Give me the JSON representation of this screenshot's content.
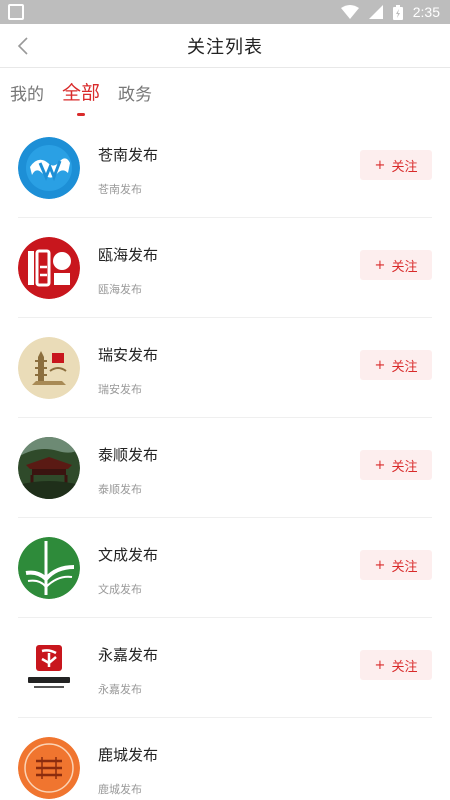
{
  "status_bar": {
    "time": "2:35"
  },
  "nav": {
    "title": "关注列表"
  },
  "tabs": [
    {
      "label": "我的",
      "active": false
    },
    {
      "label": "全部",
      "active": true
    },
    {
      "label": "政务",
      "active": false
    }
  ],
  "follow": {
    "plus": "+",
    "label": "关注"
  },
  "items": [
    {
      "name": "苍南发布",
      "sub": "苍南发布",
      "icon": "cangnan-logo-icon"
    },
    {
      "name": "瓯海发布",
      "sub": "瓯海发布",
      "icon": "ouhai-seal-icon"
    },
    {
      "name": "瑞安发布",
      "sub": "瑞安发布",
      "icon": "ruian-pagoda-icon"
    },
    {
      "name": "泰顺发布",
      "sub": "泰顺发布",
      "icon": "taishun-bridge-icon"
    },
    {
      "name": "文成发布",
      "sub": "文成发布",
      "icon": "wencheng-logo-icon"
    },
    {
      "name": "永嘉发布",
      "sub": "永嘉发布",
      "icon": "yongjia-logo-icon"
    },
    {
      "name": "鹿城发布",
      "sub": "鹿城发布",
      "icon": "lucheng-seal-icon"
    }
  ],
  "colors": {
    "accent": "#d92b2b",
    "follow_bg": "#fdeeee",
    "status_bar": "#bdbdbd"
  }
}
